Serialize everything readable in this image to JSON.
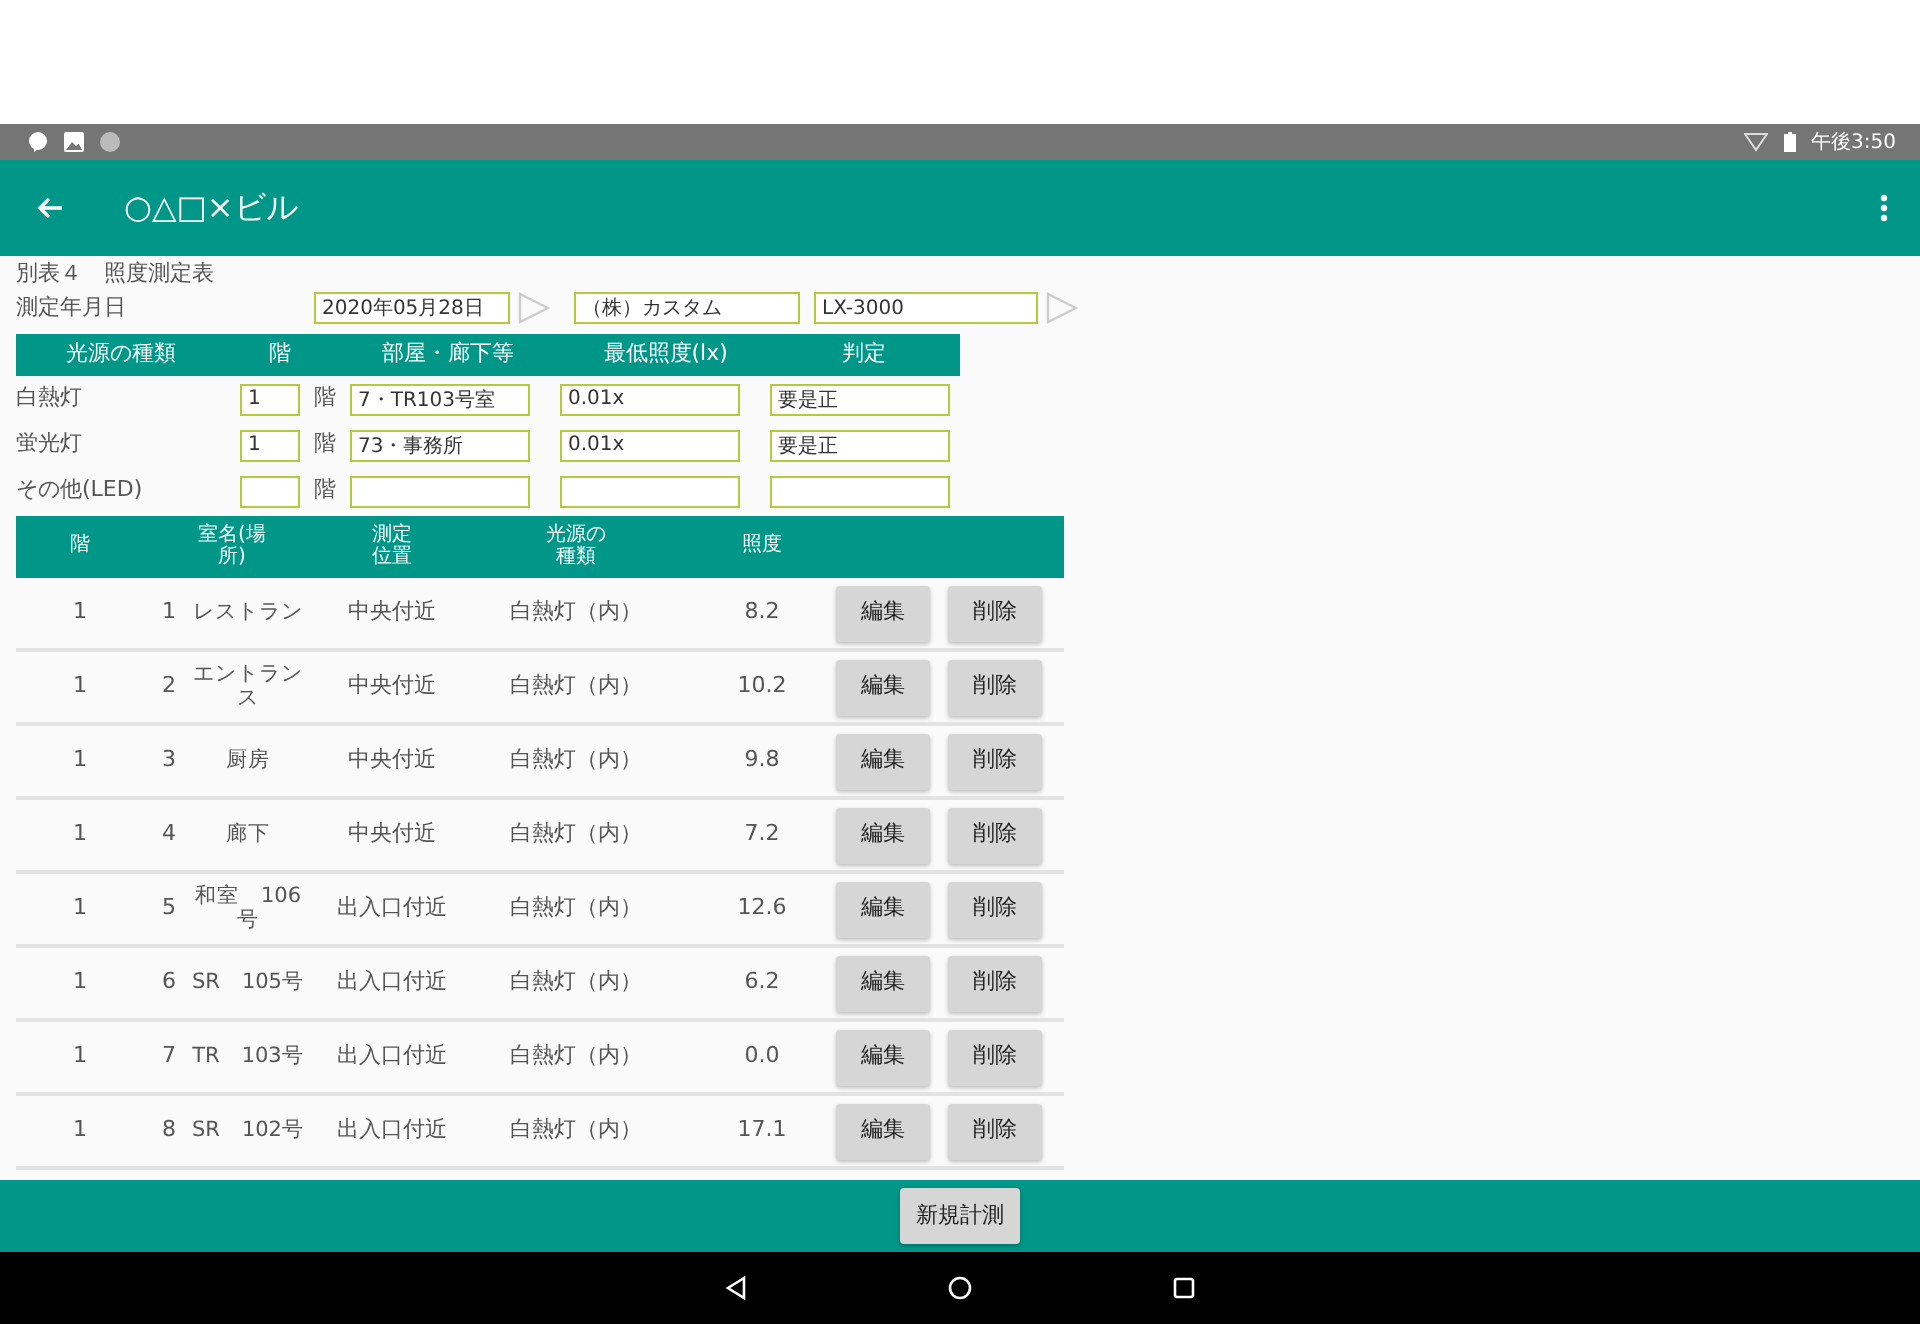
{
  "status_bar": {
    "time": "午後3:50"
  },
  "app_bar": {
    "title": "○△□×ビル"
  },
  "form": {
    "title": "別表４　照度測定表",
    "date_label": "測定年月日",
    "date": "2020年05月28日",
    "company": "（株）カスタム",
    "model": "LX-3000"
  },
  "light_table": {
    "columns": [
      "光源の種類",
      "階",
      "部屋・廊下等",
      "最低照度(lx)",
      "判定"
    ],
    "rows": [
      {
        "type": "白熱灯",
        "floor": "1",
        "floor_unit": "階",
        "room": "7・TR103号室",
        "lux": "0.01x",
        "judgement": "要是正"
      },
      {
        "type": "蛍光灯",
        "floor": "1",
        "floor_unit": "階",
        "room": "73・事務所",
        "lux": "0.01x",
        "judgement": "要是正"
      },
      {
        "type": "その他(LED)",
        "floor_unit": "階"
      }
    ]
  },
  "measurements": {
    "columns": [
      "階",
      "室名(場所)",
      "測定位置",
      "光源の種類",
      "照度"
    ],
    "rows": [
      {
        "floor": "1",
        "no": "1",
        "room": "レストラン",
        "position": "中央付近",
        "light": "白熱灯（内）",
        "lux": "8.2",
        "edit": "編集",
        "delete": "削除"
      },
      {
        "floor": "1",
        "no": "2",
        "room": "エントランス",
        "position": "中央付近",
        "light": "白熱灯（内）",
        "lux": "10.2",
        "edit": "編集",
        "delete": "削除"
      },
      {
        "floor": "1",
        "no": "3",
        "room": "厨房",
        "position": "中央付近",
        "light": "白熱灯（内）",
        "lux": "9.8",
        "edit": "編集",
        "delete": "削除"
      },
      {
        "floor": "1",
        "no": "4",
        "room": "廊下",
        "position": "中央付近",
        "light": "白熱灯（内）",
        "lux": "7.2",
        "edit": "編集",
        "delete": "削除"
      },
      {
        "floor": "1",
        "no": "5",
        "room": "和室　106号",
        "position": "出入口付近",
        "light": "白熱灯（内）",
        "lux": "12.6",
        "edit": "編集",
        "delete": "削除"
      },
      {
        "floor": "1",
        "no": "6",
        "room": "SR　105号",
        "position": "出入口付近",
        "light": "白熱灯（内）",
        "lux": "6.2",
        "edit": "編集",
        "delete": "削除"
      },
      {
        "floor": "1",
        "no": "7",
        "room": "TR　103号",
        "position": "出入口付近",
        "light": "白熱灯（内）",
        "lux": "0.0",
        "edit": "編集",
        "delete": "削除"
      },
      {
        "floor": "1",
        "no": "8",
        "room": "SR　102号",
        "position": "出入口付近",
        "light": "白熱灯（内）",
        "lux": "17.1",
        "edit": "編集",
        "delete": "削除"
      }
    ]
  },
  "footer": {
    "button": "新規計測"
  }
}
